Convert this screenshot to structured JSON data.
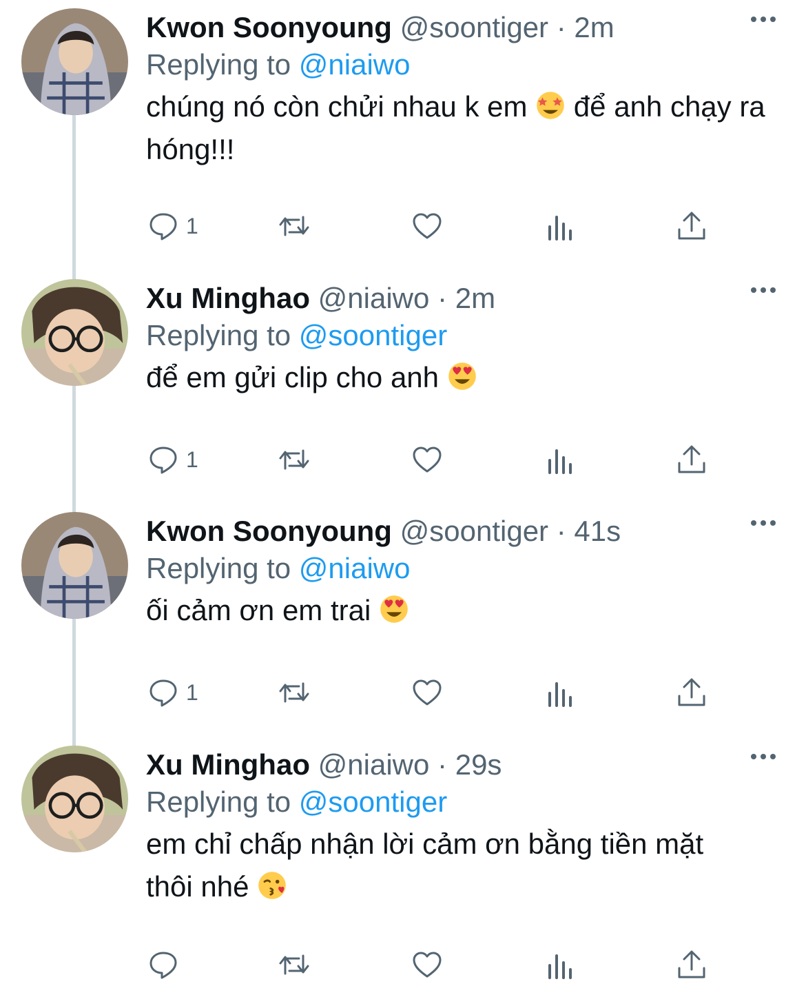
{
  "tweets": [
    {
      "name": "Kwon Soonyoung",
      "handle": "@soontiger",
      "separator": "·",
      "time": "2m",
      "replying_label": "Replying to",
      "replying_to": "@niaiwo",
      "text_parts": [
        "chúng nó còn chửi nhau k em ",
        " để anh chạy ra hóng!!!"
      ],
      "emoji": "star-struck-emoji",
      "reply_count": "1"
    },
    {
      "name": "Xu Minghao",
      "handle": "@niaiwo",
      "separator": "·",
      "time": "2m",
      "replying_label": "Replying to",
      "replying_to": "@soontiger",
      "text_parts": [
        "để em gửi clip cho anh ",
        ""
      ],
      "emoji": "heart-eyes-emoji",
      "reply_count": "1"
    },
    {
      "name": "Kwon Soonyoung",
      "handle": "@soontiger",
      "separator": "·",
      "time": "41s",
      "replying_label": "Replying to",
      "replying_to": "@niaiwo",
      "text_parts": [
        "ối cảm ơn em trai ",
        ""
      ],
      "emoji": "heart-eyes-emoji",
      "reply_count": "1"
    },
    {
      "name": "Xu Minghao",
      "handle": "@niaiwo",
      "separator": "·",
      "time": "29s",
      "replying_label": "Replying to",
      "replying_to": "@soontiger",
      "text_parts": [
        "em chỉ chấp nhận lời cảm ơn bằng tiền mặt thôi nhé ",
        ""
      ],
      "emoji": "kissing-heart-emoji",
      "reply_count": ""
    }
  ],
  "colors": {
    "text": "#0f1419",
    "secondary": "#536471",
    "link": "#1d9bf0",
    "thread_line": "#cfd9de"
  }
}
